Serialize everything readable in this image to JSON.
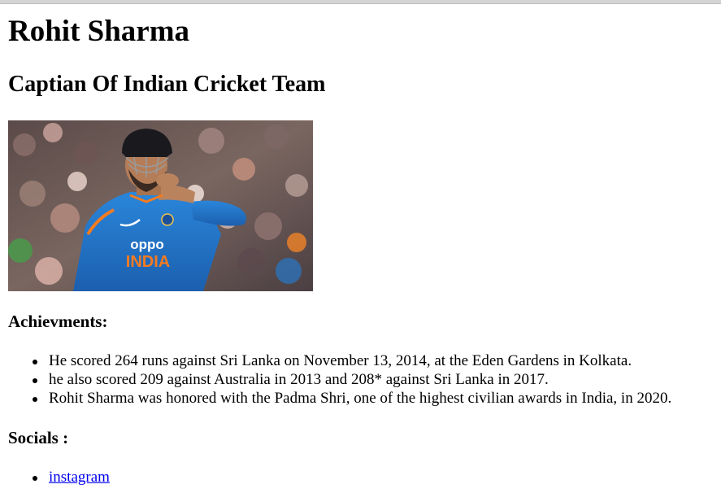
{
  "page": {
    "title": "Rohit Sharma",
    "subtitle": "Captian Of Indian Cricket Team"
  },
  "photo": {
    "jersey_sponsor": "oppo",
    "jersey_country": "INDIA",
    "colors": {
      "jersey_blue": "#1e73c8",
      "jersey_orange": "#f47b20"
    }
  },
  "achievements": {
    "heading": "Achievments:",
    "items": [
      "He scored 264 runs against Sri Lanka on November 13, 2014, at the Eden Gardens in Kolkata.",
      "he also scored 209 against Australia in 2013 and 208* against Sri Lanka in 2017.",
      "Rohit Sharma was honored with the Padma Shri, one of the highest civilian awards in India, in 2020."
    ]
  },
  "socials": {
    "heading": "Socials :",
    "links": [
      "instagram"
    ]
  }
}
